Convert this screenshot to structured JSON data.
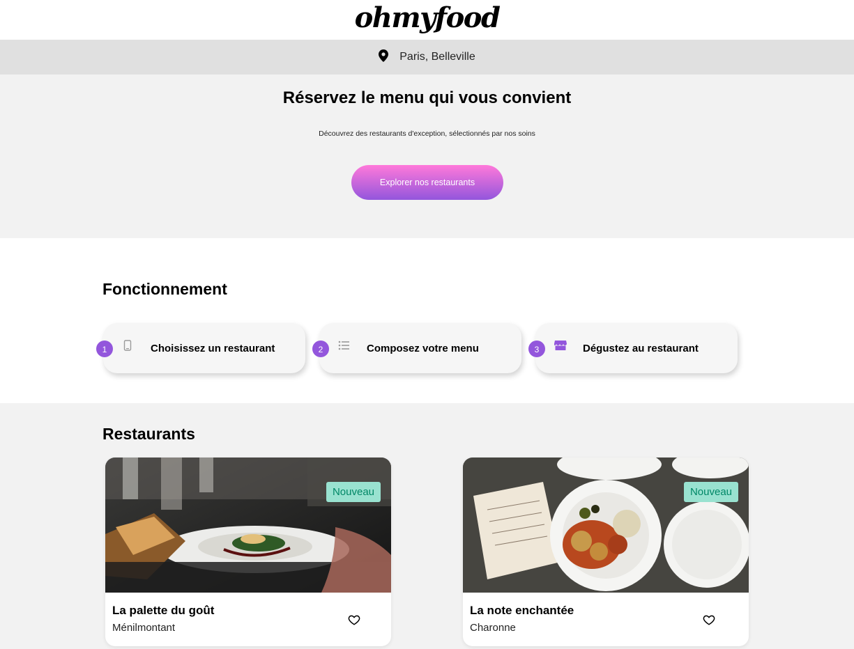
{
  "brand": {
    "logo": "ohmyfood"
  },
  "location": {
    "text": "Paris, Belleville",
    "icon": "location-pin-icon"
  },
  "hero": {
    "title": "Réservez le menu qui vous convient",
    "subtitle": "Découvrez des restaurants d'exception, sélectionnés par nos soins",
    "cta_label": "Explorer nos restaurants"
  },
  "how": {
    "title": "Fonctionnement",
    "steps": [
      {
        "number": "1",
        "label": "Choisissez un restaurant",
        "icon": "mobile-phone-icon"
      },
      {
        "number": "2",
        "label": "Composez votre menu",
        "icon": "list-icon"
      },
      {
        "number": "3",
        "label": "Dégustez au restaurant",
        "icon": "store-icon"
      }
    ]
  },
  "restaurants": {
    "title": "Restaurants",
    "items": [
      {
        "name": "La palette du goût",
        "area": "Ménilmontant",
        "badge": "Nouveau",
        "favorite_icon": "heart-outline-icon"
      },
      {
        "name": "La note enchantée",
        "area": "Charonne",
        "badge": "Nouveau",
        "favorite_icon": "heart-outline-icon"
      }
    ]
  },
  "colors": {
    "accent": "#9356dc",
    "gradient_start": "#ff79da",
    "badge_bg": "#99e2d0",
    "badge_text": "#008766"
  }
}
